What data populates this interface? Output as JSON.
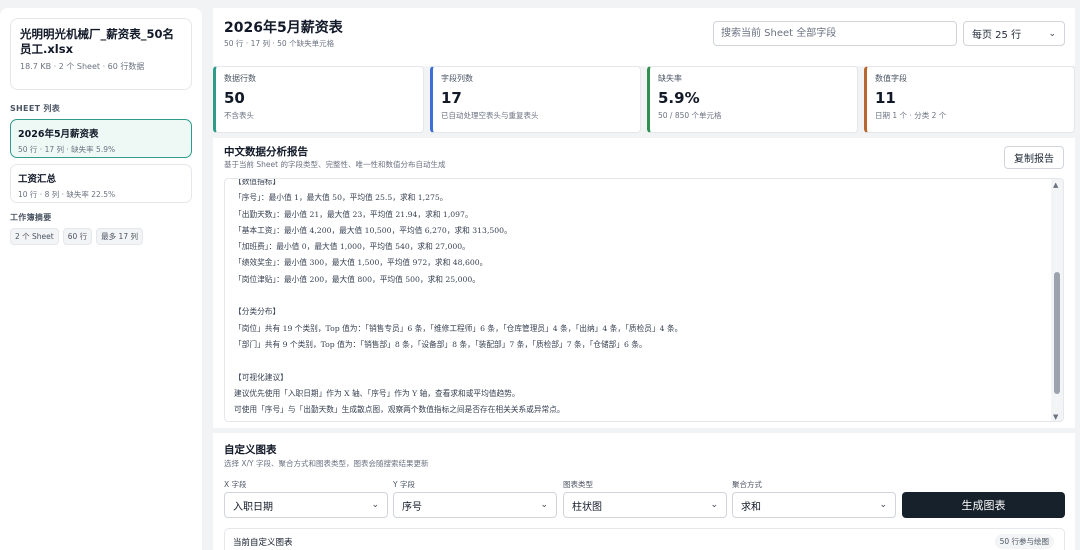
{
  "sidebar": {
    "file_name": "光明明光机械厂_薪资表_50名员工.xlsx",
    "file_meta": "18.7 KB · 2 个 Sheet · 60 行数据",
    "sheets_title": "SHEET 列表",
    "sheets": [
      {
        "name": "2026年5月薪资表",
        "meta": "50 行 · 17 列 · 缺失率 5.9%",
        "active": true
      },
      {
        "name": "工资汇总",
        "meta": "10 行 · 8 列 · 缺失率 22.5%",
        "active": false
      }
    ],
    "summary_title": "工作簿摘要",
    "summary_chips": [
      "2 个 Sheet",
      "60 行",
      "最多 17 列"
    ]
  },
  "header": {
    "title": "2026年5月薪资表",
    "subtitle": "50 行 · 17 列 · 50 个缺失单元格",
    "search_placeholder": "搜索当前 Sheet 全部字段",
    "page_size": "每页 25 行"
  },
  "stats": [
    {
      "label": "数据行数",
      "value": "50",
      "note": "不含表头",
      "color": "#2f9c8a"
    },
    {
      "label": "字段列数",
      "value": "17",
      "note": "已自动处理空表头与重复表头",
      "color": "#3b6fd4"
    },
    {
      "label": "缺失率",
      "value": "5.9%",
      "note": "50 / 850 个单元格",
      "color": "#2f8f4e"
    },
    {
      "label": "数值字段",
      "value": "11",
      "note": "日期 1 个 · 分类 2 个",
      "color": "#b8672f"
    }
  ],
  "report": {
    "title": "中文数据分析报告",
    "subtitle": "基于当前 Sheet 的字段类型、完整性、唯一性和数值分布自动生成",
    "copy_label": "复制报告",
    "lines": [
      "【数值指标】",
      "「序号」：最小值 1，最大值 50，平均值 25.5，求和 1,275。",
      "「出勤天数」：最小值 21，最大值 23，平均值 21.94，求和 1,097。",
      "「基本工资」：最小值 4,200，最大值 10,500，平均值 6,270，求和 313,500。",
      "「加班费」：最小值 0，最大值 1,000，平均值 540，求和 27,000。",
      "「绩效奖金」：最小值 300，最大值 1,500，平均值 972，求和 48,600。",
      "「岗位津贴」：最小值 200，最大值 800，平均值 500，求和 25,000。",
      "",
      "【分类分布】",
      "「岗位」共有 19 个类别，Top 值为：「销售专员」6 条，「维修工程师」6 条，「仓库管理员」4 条，「出纳」4 条，「质检员」4 条。",
      "「部门」共有 9 个类别，Top 值为：「销售部」8 条，「设备部」8 条，「装配部」7 条，「质检部」7 条，「仓储部」6 条。",
      "",
      "【可视化建议】",
      "建议优先使用「入职日期」作为 X 轴、「序号」作为 Y 轴，查看求和或平均值趋势。",
      "可使用「序号」与「出勤天数」生成散点图，观察两个数值指标之间是否存在相关关系或异常点。"
    ]
  },
  "builder": {
    "title": "自定义图表",
    "subtitle": "选择 X/Y 字段、聚合方式和图表类型，图表会随搜索结果更新",
    "fields": [
      {
        "label": "X 字段",
        "value": "入职日期"
      },
      {
        "label": "Y 字段",
        "value": "序号"
      },
      {
        "label": "图表类型",
        "value": "柱状图"
      },
      {
        "label": "聚合方式",
        "value": "求和"
      }
    ],
    "generate_label": "生成图表",
    "current_title": "当前自定义图表",
    "current_badge": "50 行参与绘图"
  }
}
